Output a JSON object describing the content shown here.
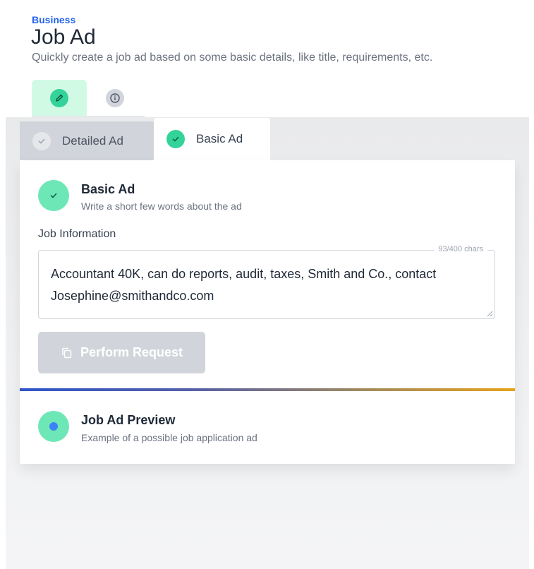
{
  "header": {
    "eyebrow": "Business",
    "title": "Job Ad",
    "subtitle": "Quickly create a job ad based on some basic details, like title, requirements, etc."
  },
  "mode_tabs": [
    {
      "icon": "pencil-icon",
      "active": true
    },
    {
      "icon": "info-icon",
      "active": false
    }
  ],
  "tabs": {
    "detailed": {
      "label": "Detailed Ad",
      "icon": "check-icon"
    },
    "basic": {
      "label": "Basic Ad",
      "icon": "check-icon",
      "active": true
    }
  },
  "form": {
    "step_title": "Basic Ad",
    "step_desc": "Write a short few words about the ad",
    "field_label": "Job Information",
    "char_count": "93/400 chars",
    "job_text": "Accountant 40K, can do reports, audit, taxes, Smith and Co., contact Josephine@smithandco.com",
    "perform_label": "Perform Request"
  },
  "preview": {
    "title": "Job Ad Preview",
    "desc": "Example of a possible job application ad"
  },
  "colors": {
    "accent_green": "#34d399",
    "brand_blue": "#2563eb",
    "divider_start": "#2f55c8",
    "divider_end": "#e8a21a"
  }
}
